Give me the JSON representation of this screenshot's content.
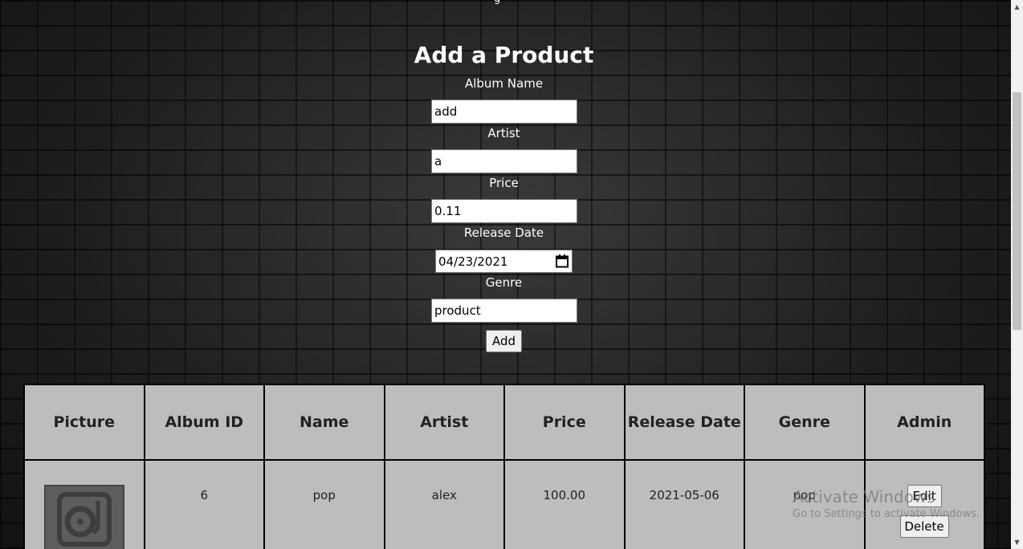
{
  "top_partial_text": "g",
  "form": {
    "title": "Add a Product",
    "album_name_label": "Album Name",
    "album_name_value": "add",
    "artist_label": "Artist",
    "artist_value": "a",
    "price_label": "Price",
    "price_value": "0.11",
    "release_date_label": "Release Date",
    "release_date_value": "04/23/2021",
    "genre_label": "Genre",
    "genre_value": "product",
    "add_button": "Add"
  },
  "table": {
    "headers": [
      "Picture",
      "Album ID",
      "Name",
      "Artist",
      "Price",
      "Release Date",
      "Genre",
      "Admin"
    ],
    "rows": [
      {
        "picture_icon": "vinyl-record-icon",
        "album_id": "6",
        "name": "pop",
        "artist": "alex",
        "price": "100.00",
        "release_date": "2021-05-06",
        "genre": "pop",
        "edit_button": "Edit",
        "delete_button": "Delete"
      }
    ]
  },
  "watermark": {
    "line1": "Activate Windows",
    "line2": "Go to Settings to activate Windows."
  },
  "colors": {
    "table_bg": "#bdbdbd",
    "page_bg": "#1c1c1c",
    "text_light": "#ffffff"
  }
}
